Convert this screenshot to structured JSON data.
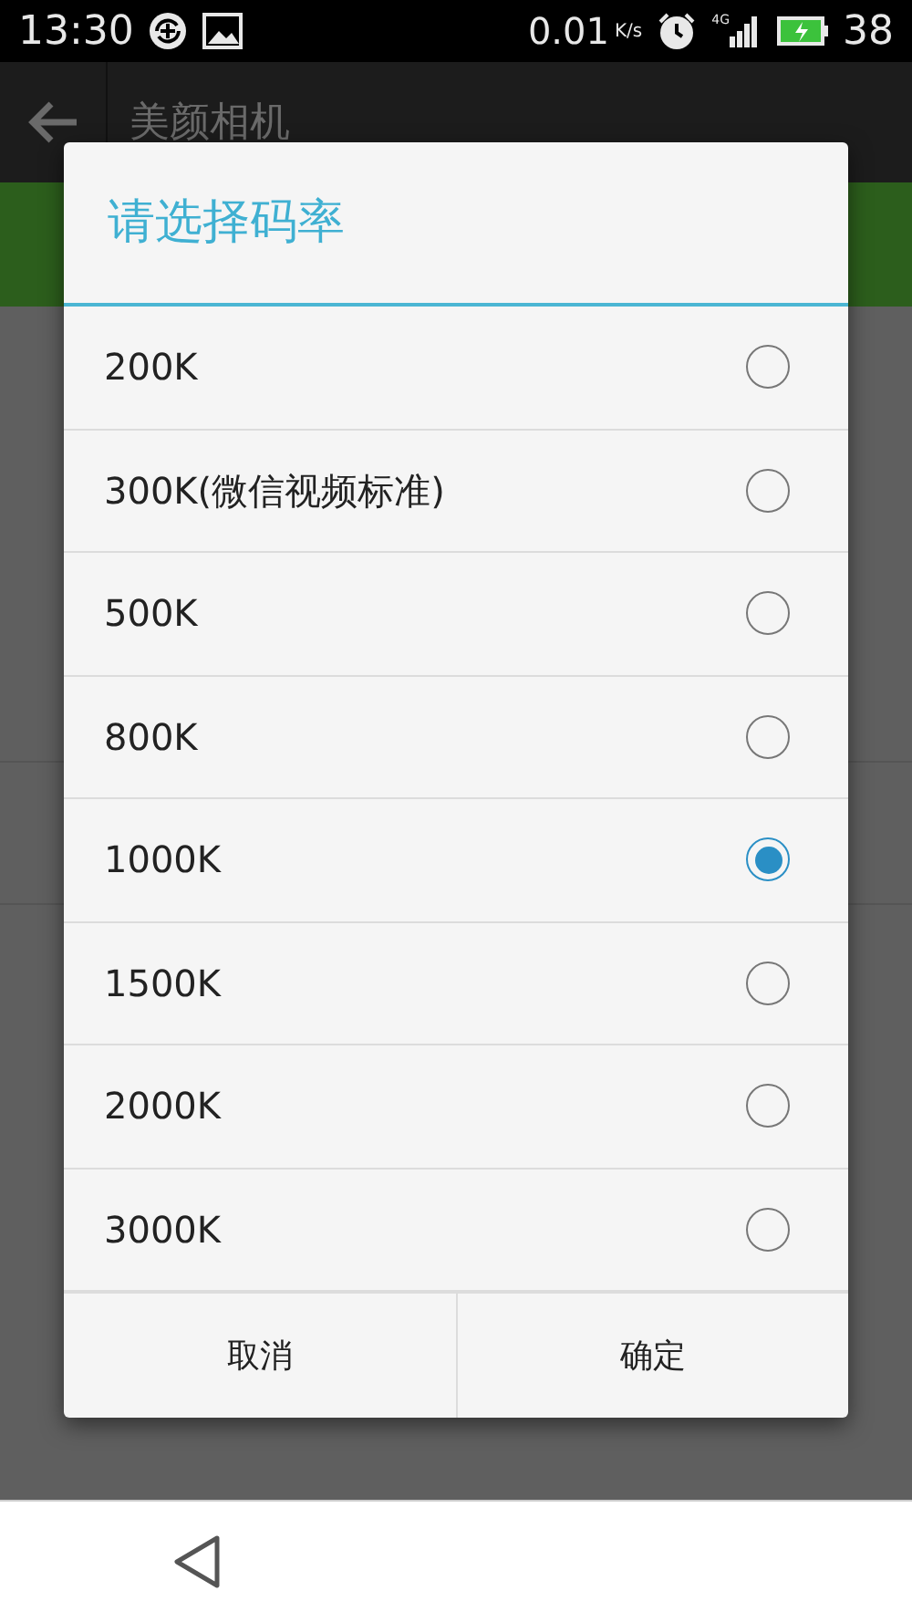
{
  "status_bar": {
    "time": "13:30",
    "speed": "0.01",
    "speed_unit": "K/s",
    "network": "4G",
    "battery": "38"
  },
  "app_bar": {
    "title": "美颜相机"
  },
  "dialog": {
    "title": "请选择码率",
    "options": [
      {
        "label": "200K",
        "selected": false
      },
      {
        "label": "300K(微信视频标准)",
        "selected": false
      },
      {
        "label": "500K",
        "selected": false
      },
      {
        "label": "800K",
        "selected": false
      },
      {
        "label": "1000K",
        "selected": true
      },
      {
        "label": "1500K",
        "selected": false
      },
      {
        "label": "2000K",
        "selected": false
      },
      {
        "label": "3000K",
        "selected": false
      }
    ],
    "buttons": [
      "取消",
      "确定"
    ]
  }
}
